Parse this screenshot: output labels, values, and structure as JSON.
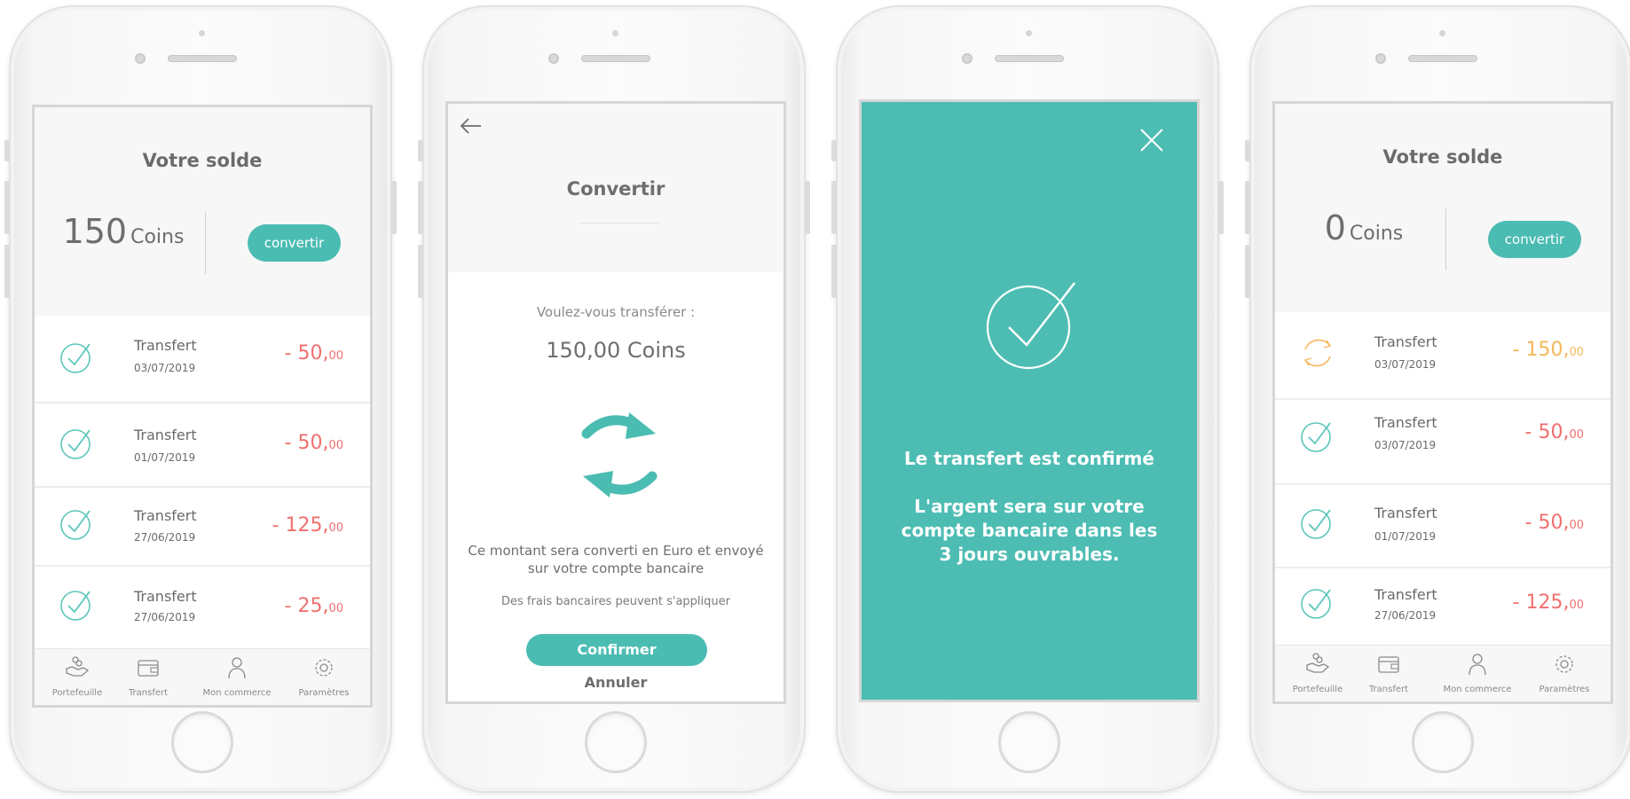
{
  "colors": {
    "teal": "#4bbcb2",
    "debit_red": "#f0706f",
    "pending_orange": "#f5b85b",
    "text_gray": "#6b6b6b"
  },
  "tabbar": {
    "items": [
      {
        "label": "Portefeuille",
        "icon": "hand-coins-icon"
      },
      {
        "label": "Transfert",
        "icon": "wallet-icon"
      },
      {
        "label": "Mon commerce",
        "icon": "user-icon"
      },
      {
        "label": "Paramètres",
        "icon": "gear-icon"
      }
    ]
  },
  "screen1": {
    "title": "Votre solde",
    "balance": "150",
    "unit": "Coins",
    "convert_label": "convertir",
    "transactions": [
      {
        "title": "Transfert",
        "date": "03/07/2019",
        "amount": "- 50,",
        "cents": "00",
        "status": "done"
      },
      {
        "title": "Transfert",
        "date": "01/07/2019",
        "amount": "- 50,",
        "cents": "00",
        "status": "done"
      },
      {
        "title": "Transfert",
        "date": "27/06/2019",
        "amount": "- 125,",
        "cents": "00",
        "status": "done"
      },
      {
        "title": "Transfert",
        "date": "27/06/2019",
        "amount": "- 25,",
        "cents": "00",
        "status": "done"
      }
    ]
  },
  "screen2": {
    "title": "Convertir",
    "question": "Voulez-vous transférer :",
    "amount": "150,00 Coins",
    "note": "Ce montant sera converti en Euro et envoyé sur votre compte bancaire",
    "fees": "Des frais bancaires peuvent s'appliquer",
    "confirm_label": "Confirmer",
    "cancel_label": "Annuler"
  },
  "screen3": {
    "title": "Le transfert est confirmé",
    "message": "L'argent sera sur votre compte bancaire dans les 3 jours ouvrables."
  },
  "screen4": {
    "title": "Votre solde",
    "balance": "0",
    "unit": "Coins",
    "convert_label": "convertir",
    "transactions": [
      {
        "title": "Transfert",
        "date": "03/07/2019",
        "amount": "- 150,",
        "cents": "00",
        "status": "pending"
      },
      {
        "title": "Transfert",
        "date": "03/07/2019",
        "amount": "- 50,",
        "cents": "00",
        "status": "done"
      },
      {
        "title": "Transfert",
        "date": "01/07/2019",
        "amount": "- 50,",
        "cents": "00",
        "status": "done"
      },
      {
        "title": "Transfert",
        "date": "27/06/2019",
        "amount": "- 125,",
        "cents": "00",
        "status": "done"
      }
    ]
  }
}
